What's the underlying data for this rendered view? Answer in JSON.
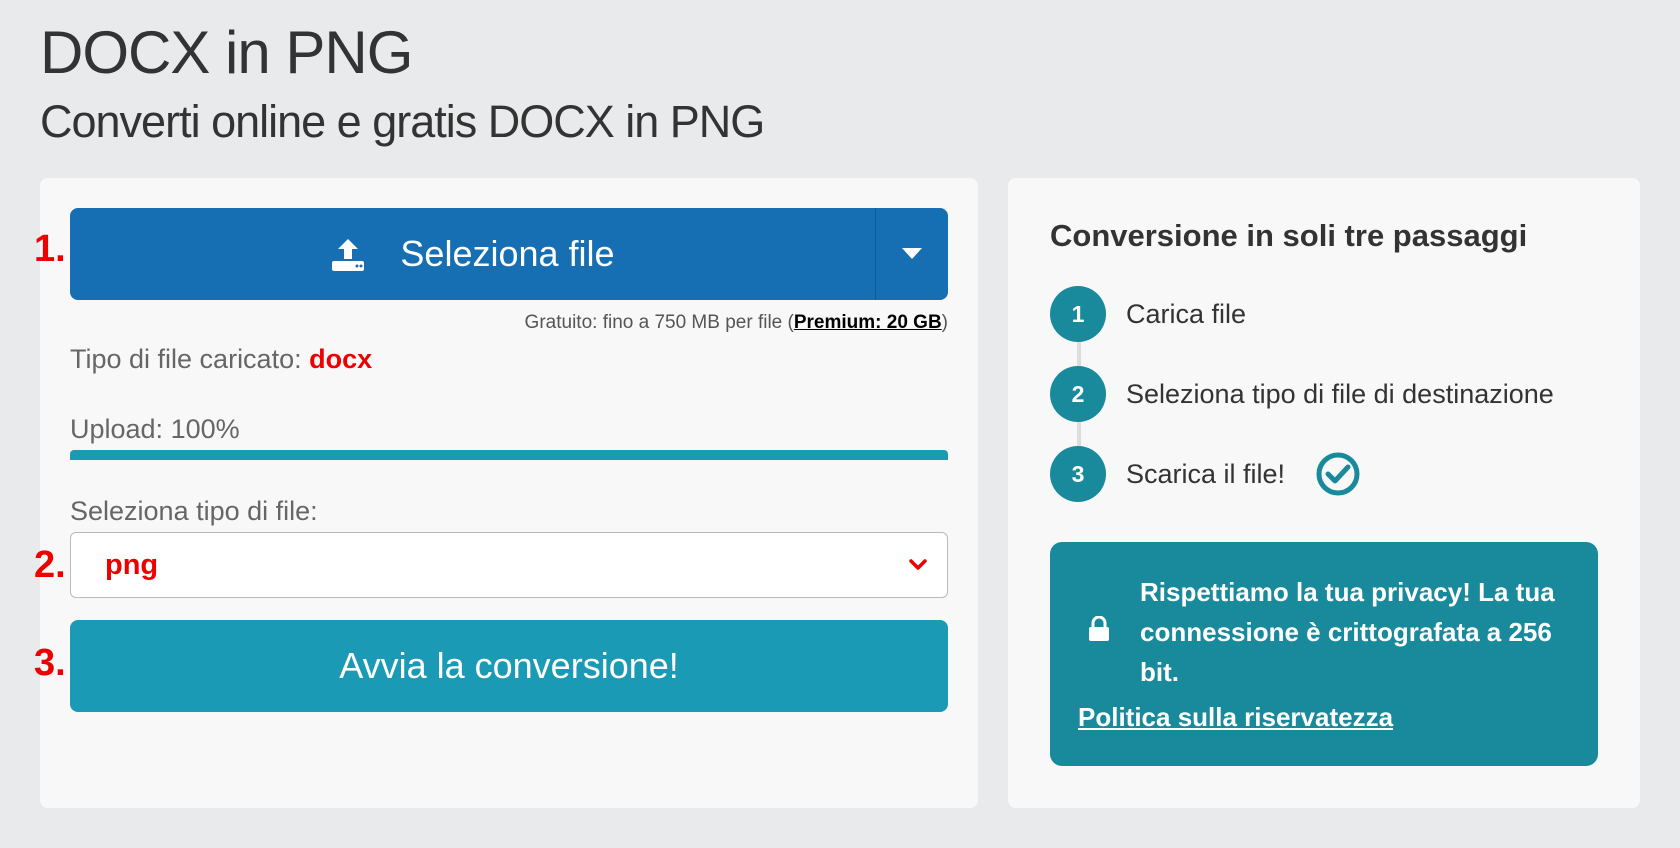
{
  "header": {
    "title": "DOCX in PNG",
    "subtitle": "Converti online e gratis DOCX in PNG"
  },
  "steps_markers": [
    "1.",
    "2.",
    "3."
  ],
  "upload": {
    "button_label": "Seleziona file",
    "limit_prefix": "Gratuito: fino a 750 MB per file (",
    "premium_link": "Premium: 20 GB",
    "limit_suffix": ")"
  },
  "file_info": {
    "label": "Tipo di file caricato:",
    "value": "docx"
  },
  "progress": {
    "label": "Upload: 100%",
    "value": 100
  },
  "target": {
    "label": "Seleziona tipo di file:",
    "selected": "png"
  },
  "convert_button": "Avvia la conversione!",
  "sidebar": {
    "title": "Conversione in soli tre passaggi",
    "steps": [
      {
        "num": "1",
        "text": "Carica file"
      },
      {
        "num": "2",
        "text": "Seleziona tipo di file di destinazione"
      },
      {
        "num": "3",
        "text": "Scarica il file!"
      }
    ],
    "privacy_text": "Rispettiamo la tua privacy! La tua connessione è crittografata a 256 bit.",
    "privacy_link": "Politica sulla riservatezza"
  },
  "colors": {
    "upload_button": "#176fb3",
    "convert_button": "#1b9ab5",
    "accent_teal": "#188a9c",
    "highlight_red": "#ee0000"
  },
  "icons": [
    "upload-icon",
    "chevron-down-icon",
    "check-circle-icon",
    "lock-icon"
  ]
}
